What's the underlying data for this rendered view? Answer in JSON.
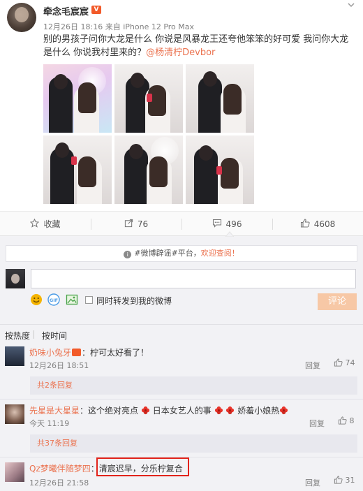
{
  "post": {
    "username": "牵念毛宸宸",
    "badge": "vip",
    "time": "12月26日 18:16",
    "source_prefix": "来自",
    "device": "iPhone 12 Pro Max",
    "text": "别的男孩子问你大龙是什么 你说是风暴龙王还夸他笨笨的好可爱 我问你大龙是什么 你说我村里来的？",
    "mention": "@杨清柠Devbor",
    "more_icon": "chevron-down-icon"
  },
  "actions": {
    "favorite": "收藏",
    "repost_count": "76",
    "comment_count": "496",
    "like_count": "4608"
  },
  "comment_box": {
    "rumor_prefix": "#微博辟谣#平台，",
    "rumor_link": "欢迎查阅！",
    "input_value": "",
    "repost_label": "同时转发到我的微博",
    "submit": "评论"
  },
  "sort": {
    "hot": "按热度",
    "time": "按时间"
  },
  "comments": [
    {
      "name": "奶味小兔牙",
      "sep": "：",
      "text": "柠可太好看了！",
      "time": "12月26日 18:51",
      "reply": "回复",
      "likes": "74",
      "sub_replies": "共2条回复"
    },
    {
      "name": "先星是大星星",
      "sep": "：",
      "text_a": "这个绝对亮点",
      "text_b": "日本女艺人的事",
      "text_c": "娇羞小娘热",
      "time": "今天 11:19",
      "reply": "回复",
      "likes": "8",
      "sub_replies": "共37条回复"
    },
    {
      "name": "Qz梦曦伴随梦四",
      "sep": "：",
      "text": "清宸迟早，分乐柠复合",
      "time": "12月26日 21:58",
      "reply": "回复",
      "likes": "31"
    }
  ],
  "colors": {
    "accent": "#eb7350",
    "highlight": "#e2231a",
    "submit_disabled": "#f7c8a6"
  }
}
